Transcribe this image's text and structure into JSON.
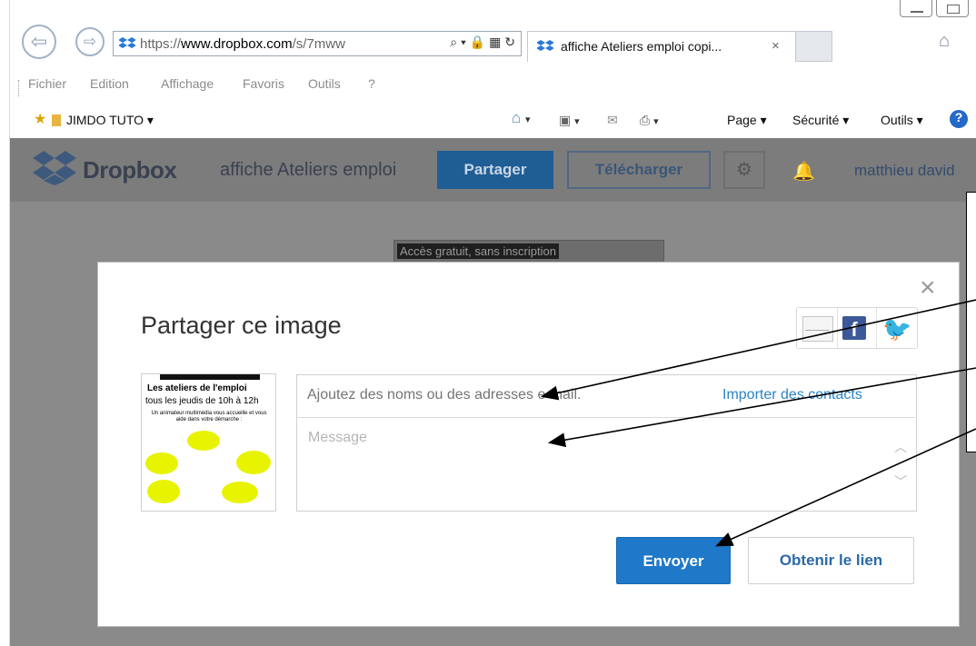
{
  "browser": {
    "url_prefix": "https://",
    "url_host": "www.dropbox.com",
    "url_path": "/s/7mww",
    "tab_title": "affiche Ateliers emploi copi...",
    "tab_close": "×",
    "menu": [
      "Fichier",
      "Edition",
      "Affichage",
      "Favoris",
      "Outils",
      "?"
    ],
    "favorites_folder": "JIMDO TUTO ▾",
    "command_bar": {
      "page": "Page ▾",
      "security": "Sécurité ▾",
      "tools": "Outils ▾"
    }
  },
  "dropbox": {
    "brand": "Dropbox",
    "file_name": "affiche Ateliers emploi",
    "share_button": "Partager",
    "download_button": "Télécharger",
    "user_name": "matthieu david",
    "banner": "Accès gratuit, sans inscription"
  },
  "modal": {
    "title": "Partager ce image",
    "close": "×",
    "to_placeholder": "Ajoutez des noms ou des adresses e-mail.",
    "import_contacts": "Importer des contacts",
    "message_placeholder": "Message",
    "send_button": "Envoyer",
    "get_link_button": "Obtenir le lien",
    "thumbnail": {
      "line1": "Les ateliers de l'emploi",
      "line2": "tous les jeudis de 10h à 12h",
      "line3": "Un animateur multimédia vous accueille et vous aide dans votre démarche :"
    }
  },
  "colors": {
    "dropbox_blue": "#1f78c8",
    "link_blue": "#2a83c6",
    "overlay_gray": "#8a8a8a",
    "facebook": "#3b5998",
    "twitter": "#1da1f2"
  }
}
